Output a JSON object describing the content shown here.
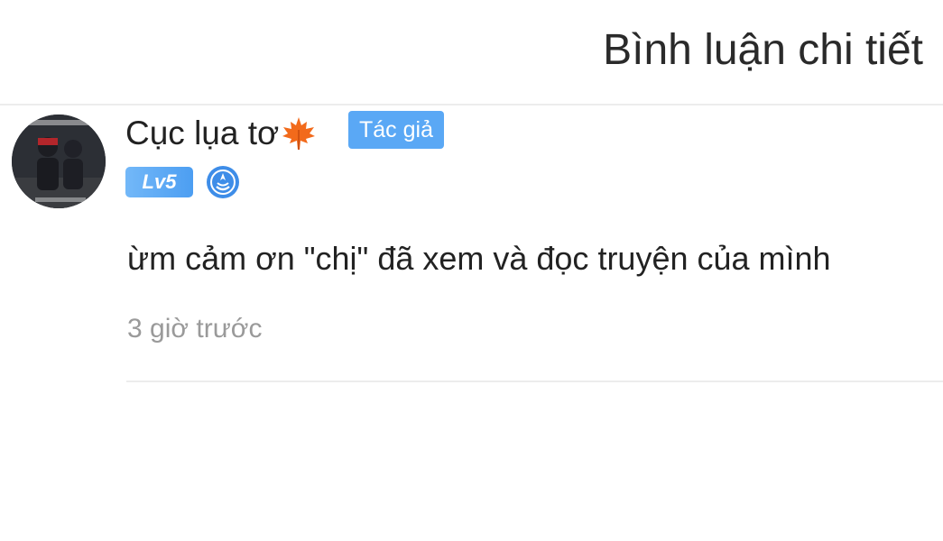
{
  "header": {
    "title": "Bình luận chi tiết"
  },
  "comment": {
    "username": "Cục lụa tơ",
    "username_icon": "maple-leaf-icon",
    "author_badge": "Tác giả",
    "level_badge": "Lv5",
    "medal_icon": "medal-icon",
    "avatar_icon": "avatar-photo",
    "text": "ừm cảm ơn \"chị\" đã xem và đọc truyện của mình",
    "timestamp": "3 giờ trước"
  },
  "colors": {
    "badge_blue": "#5aa8f5",
    "timestamp_gray": "#9a9a9a",
    "divider": "#ececec",
    "leaf_orange": "#f26a1b"
  }
}
